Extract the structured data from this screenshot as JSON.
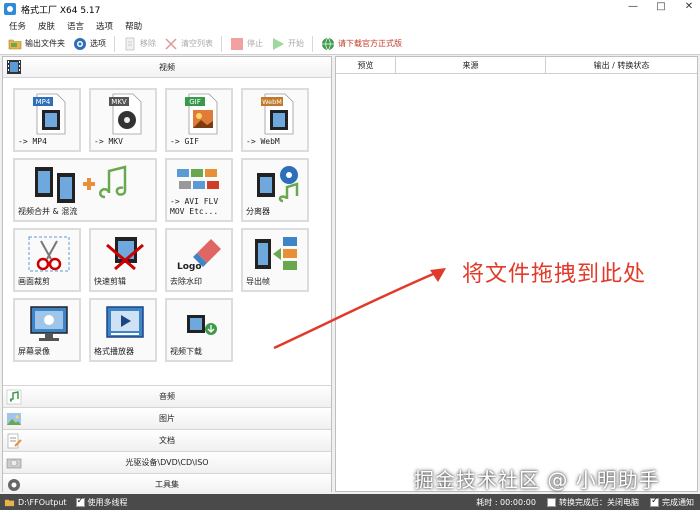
{
  "window": {
    "title": "格式工厂 X64 5.17",
    "controls": [
      "—",
      "□",
      "✕"
    ]
  },
  "menu": [
    "任务",
    "皮肤",
    "语言",
    "选项",
    "帮助"
  ],
  "toolbar": {
    "output_folder": "输出文件夹",
    "options": "选项",
    "remove": "移除",
    "clear_list": "清空列表",
    "stop": "停止",
    "start": "开始",
    "download": "请下载官方正式版"
  },
  "sections": {
    "video": "视频",
    "audio": "音频",
    "image": "图片",
    "document": "文档",
    "disc": "光驱设备\\DVD\\CD\\ISO",
    "tools": "工具集"
  },
  "tiles": [
    {
      "label": "-> MP4",
      "badge": "MP4"
    },
    {
      "label": "-> MKV",
      "badge": "MKV"
    },
    {
      "label": "-> GIF",
      "badge": "GIF"
    },
    {
      "label": "-> WebM",
      "badge": "WebM"
    },
    {
      "label": "视频合并 & 混流"
    },
    {
      "label": "-> AVI FLV\nMOV Etc..."
    },
    {
      "label": "分离器"
    },
    {
      "label": "画面裁剪"
    },
    {
      "label": "快速剪辑"
    },
    {
      "label": "去除水印",
      "badge": "Logo"
    },
    {
      "label": "导出帧"
    },
    {
      "label": "屏幕录像"
    },
    {
      "label": "格式播放器"
    },
    {
      "label": "视频下载"
    }
  ],
  "table": {
    "columns": [
      "预览",
      "来源",
      "输出 / 转换状态"
    ]
  },
  "drop_hint": "将文件拖拽到此处",
  "watermark": "掘金技术社区 @ 小明助手",
  "status": {
    "output_path": "D:\\FFOutput",
    "multithread": "使用多线程",
    "elapsed": "耗时 : 00:00:00",
    "after_done": "转换完成后：关闭电脑",
    "notify": "完成通知"
  },
  "colors": {
    "accent_red": "#e23a2a",
    "statusbar": "#4a4a4a"
  }
}
